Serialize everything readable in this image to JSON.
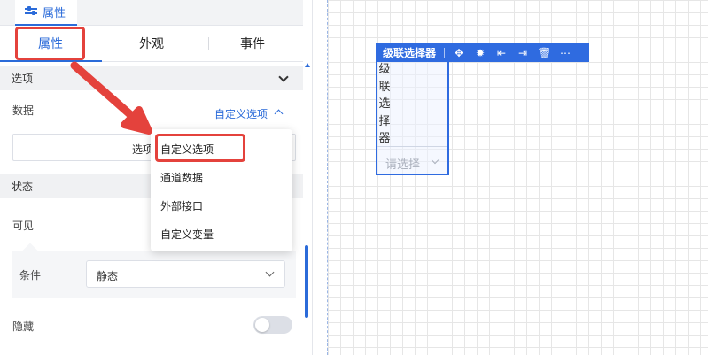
{
  "header": {
    "tab_label": "属性",
    "tab_icon": "sliders-icon"
  },
  "tabs": [
    {
      "label": "属性",
      "active": true
    },
    {
      "label": "外观",
      "active": false
    },
    {
      "label": "事件",
      "active": false
    }
  ],
  "options_section": {
    "title": "选项",
    "data_label": "数据",
    "data_value": "自定义选项",
    "options_button_label": "选项"
  },
  "dropdown": {
    "items": [
      "自定义选项",
      "通道数据",
      "外部接口",
      "自定义变量"
    ],
    "highlighted_index": 0
  },
  "state_section": {
    "title": "状态",
    "visible_label": "可见",
    "condition_label": "条件",
    "condition_value": "静态",
    "hidden_label": "隐藏",
    "hidden_on": false
  },
  "canvas": {
    "component_title": "级联选择器",
    "component_label_chars": [
      "级",
      "联",
      "选",
      "择",
      "器"
    ],
    "component_placeholder": "请选择",
    "toolbar_icons": [
      "move-icon",
      "bug-icon",
      "align-left-icon",
      "align-right-icon",
      "trash-icon",
      "more-icon"
    ]
  },
  "colors": {
    "accent": "#2b6bd9",
    "annotation_red": "#e4423c",
    "component_blue": "#2f6be0"
  }
}
